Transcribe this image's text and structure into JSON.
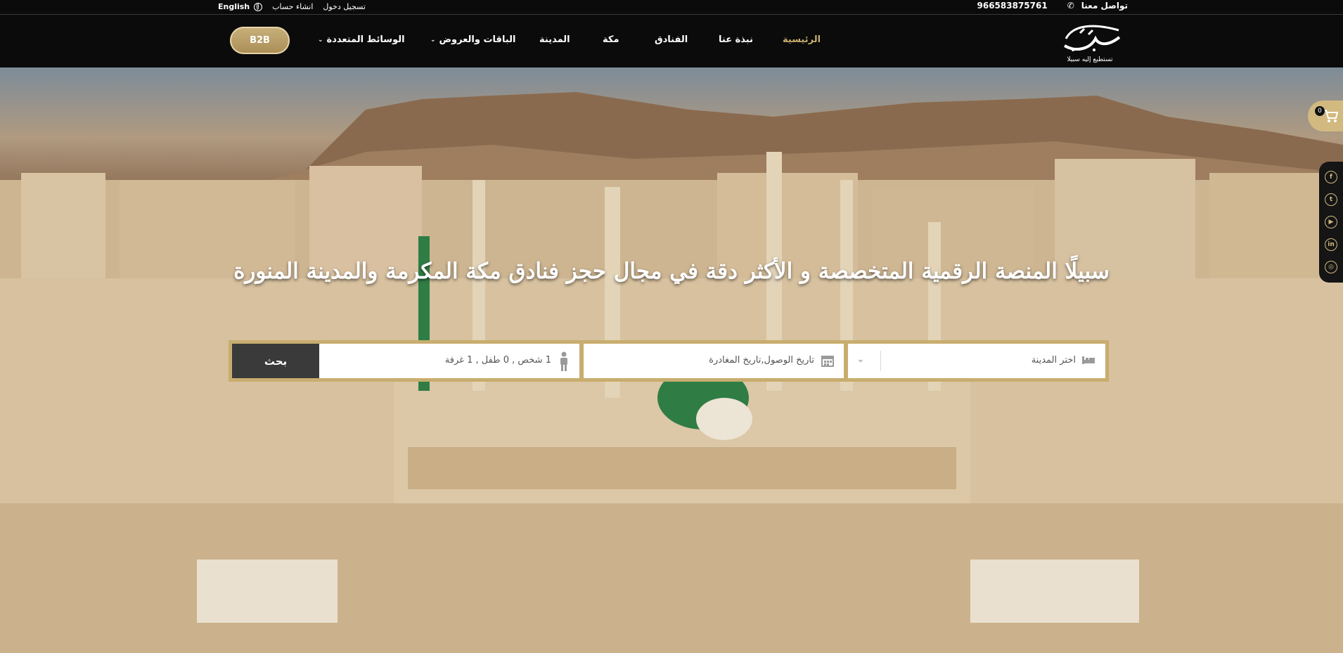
{
  "topbar": {
    "login": "تسجيل دخول",
    "register": "انشاء حساب",
    "language": "English",
    "phone": "966583875761",
    "contact_label": "تواصل معنا"
  },
  "nav": {
    "b2b": "B2B",
    "items": [
      {
        "label": "الرئيسية",
        "active": true
      },
      {
        "label": "نبذة عنا"
      },
      {
        "label": "الفنادق"
      },
      {
        "label": "مكة"
      },
      {
        "label": "المدينة"
      },
      {
        "label": "الباقات والعروض",
        "dropdown": true
      },
      {
        "label": "الوسائط المتعددة",
        "dropdown": true
      }
    ],
    "logo_tagline": "تستطيع إليه سبيلا"
  },
  "hero": {
    "title": "سبيلًا المنصة الرقمية المتخصصة و الأكثر دقة في مجال حجز فنادق مكة المكرمة والمدينة المنورة"
  },
  "search": {
    "city_placeholder": "اختر المدينة",
    "dates_placeholder": "تاريخ الوصول,تاريخ المغادرة",
    "guests_value": "1 شخص , 0 طفل , 1 غرفة",
    "button": "بحث"
  },
  "cart": {
    "count": "0"
  },
  "social": [
    "facebook-icon",
    "twitter-icon",
    "youtube-icon",
    "linkedin-icon",
    "instagram-icon"
  ],
  "colors": {
    "accent": "#c8ad6e",
    "dark": "#0b0b0b",
    "search_button": "#3a3a3a"
  }
}
